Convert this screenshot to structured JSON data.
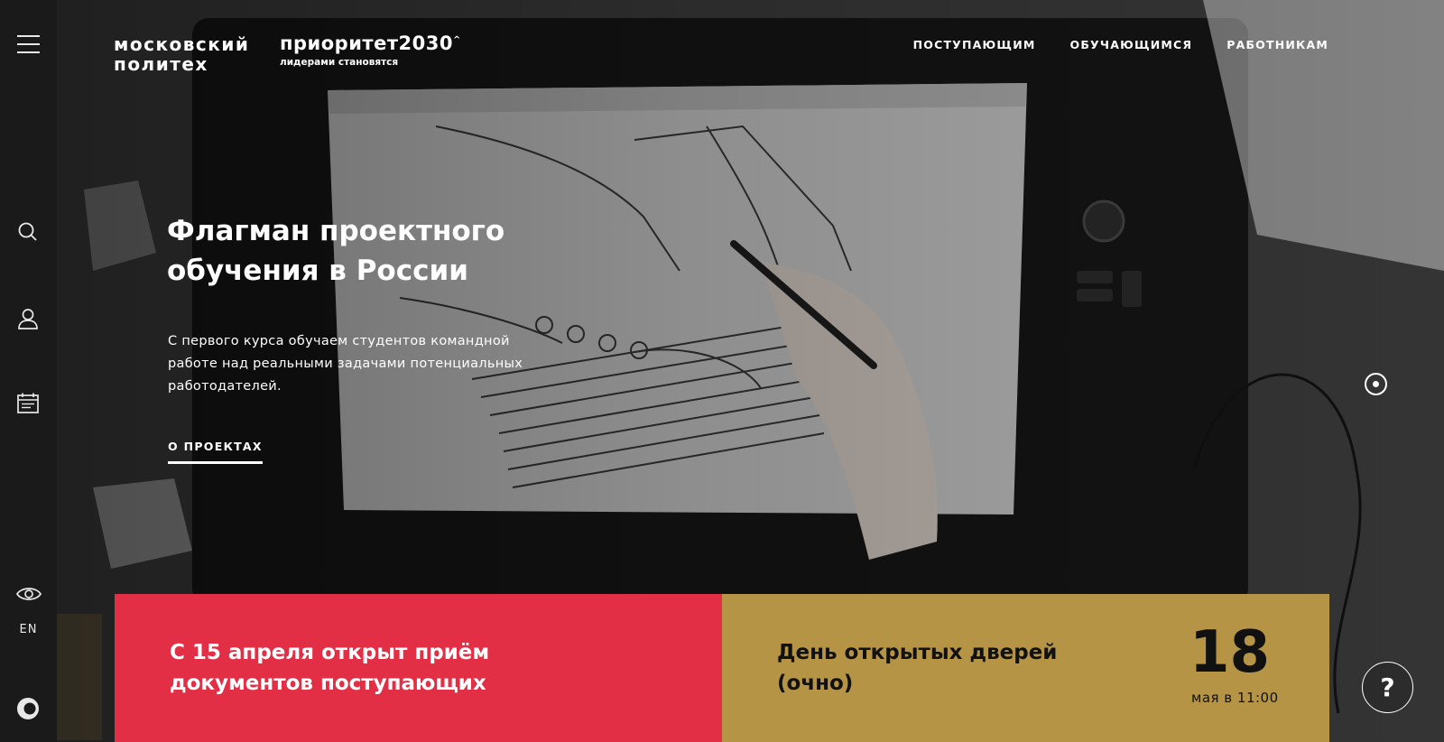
{
  "header": {
    "logo_line1": "московский",
    "logo_line2": "политех",
    "priority_logo": "приоритет2030",
    "priority_caret": "^",
    "priority_tagline": "лидерами становятся",
    "nav": [
      {
        "label": "ПОСТУПАЮЩИМ"
      },
      {
        "label": "ОБУЧАЮЩИМСЯ"
      },
      {
        "label": "РАБОТНИКАМ"
      }
    ]
  },
  "sidebar": {
    "icons": [
      "menu-icon",
      "search-icon",
      "user-icon",
      "calendar-icon",
      "eye-icon",
      "brand-mark-icon"
    ],
    "lang": "EN"
  },
  "hero": {
    "title": "Флагман проектного обучения в России",
    "text": "С первого курса обучаем студентов командной работе над реальными задачами потенциальных работодателей.",
    "link": "О ПРОЕКТАХ",
    "slides_count": 1,
    "active_slide": 1
  },
  "cards": {
    "admission": "С 15 апреля открыт приём документов поступающих",
    "openday_title": "День открытых дверей (очно)",
    "openday_day": "18",
    "openday_when": "мая в 11:00"
  },
  "help": {
    "label": "?"
  },
  "colors": {
    "red_card": "#e32f45",
    "gold_card": "#b59446",
    "sidebar": "#1a1a1a"
  }
}
